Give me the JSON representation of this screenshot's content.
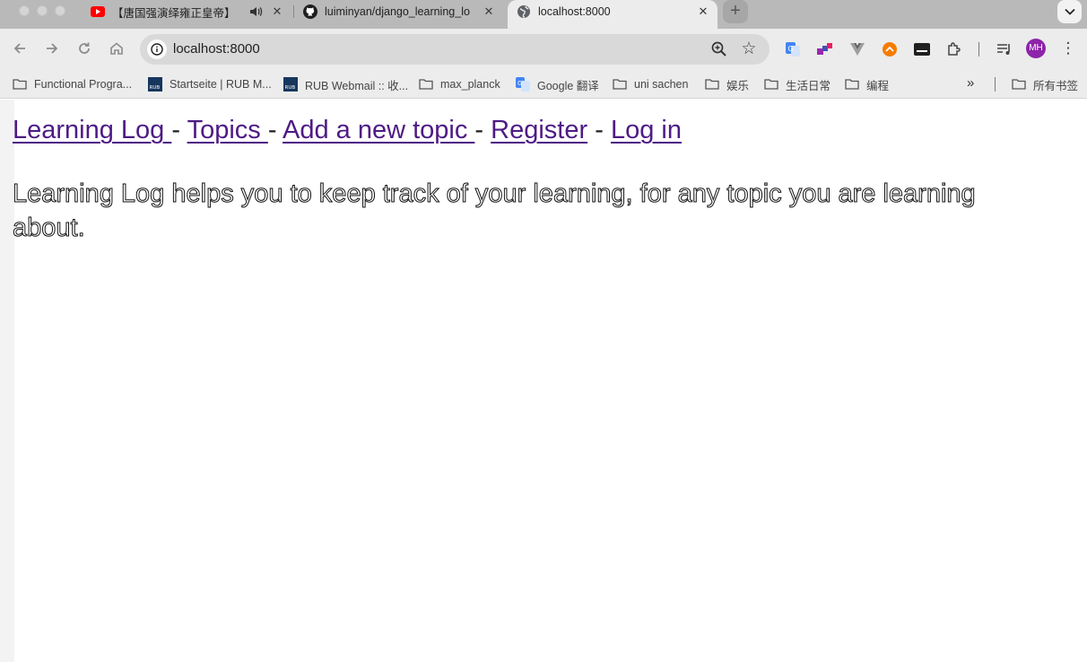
{
  "tabs": [
    {
      "title": "【唐国强演绎雍正皇帝】",
      "favicon": "youtube-icon",
      "audio": true
    },
    {
      "title": "luiminyan/django_learning_lo",
      "favicon": "github-icon"
    },
    {
      "title": "localhost:8000",
      "favicon": "globe-icon",
      "active": true
    }
  ],
  "toolbar": {
    "url": "localhost:8000",
    "avatar_initials": "MH"
  },
  "bookmarks": {
    "items": [
      {
        "label": "Functional Progra...",
        "icon": "folder-icon"
      },
      {
        "label": "Startseite | RUB M...",
        "icon": "rub-logo-icon"
      },
      {
        "label": "RUB Webmail :: 收...",
        "icon": "rub-logo-icon"
      },
      {
        "label": "max_planck",
        "icon": "folder-icon"
      },
      {
        "label": "Google 翻译",
        "icon": "google-translate-icon"
      },
      {
        "label": "uni sachen",
        "icon": "folder-icon"
      },
      {
        "label": "娱乐",
        "icon": "folder-icon"
      },
      {
        "label": "生活日常",
        "icon": "folder-icon"
      },
      {
        "label": "编程",
        "icon": "folder-icon"
      }
    ],
    "all_bookmarks": "所有书签"
  },
  "page": {
    "nav": {
      "home": "Learning Log ",
      "topics": "Topics ",
      "new_topic": "Add a new topic ",
      "register": "Register",
      "login": "Log in",
      "separator": "-"
    },
    "lead": "Learning Log helps you to keep track of your learning, for any topic you are learning about."
  },
  "colors": {
    "link_visited": "#4e1b84",
    "avatar_bg": "#8e24aa"
  }
}
